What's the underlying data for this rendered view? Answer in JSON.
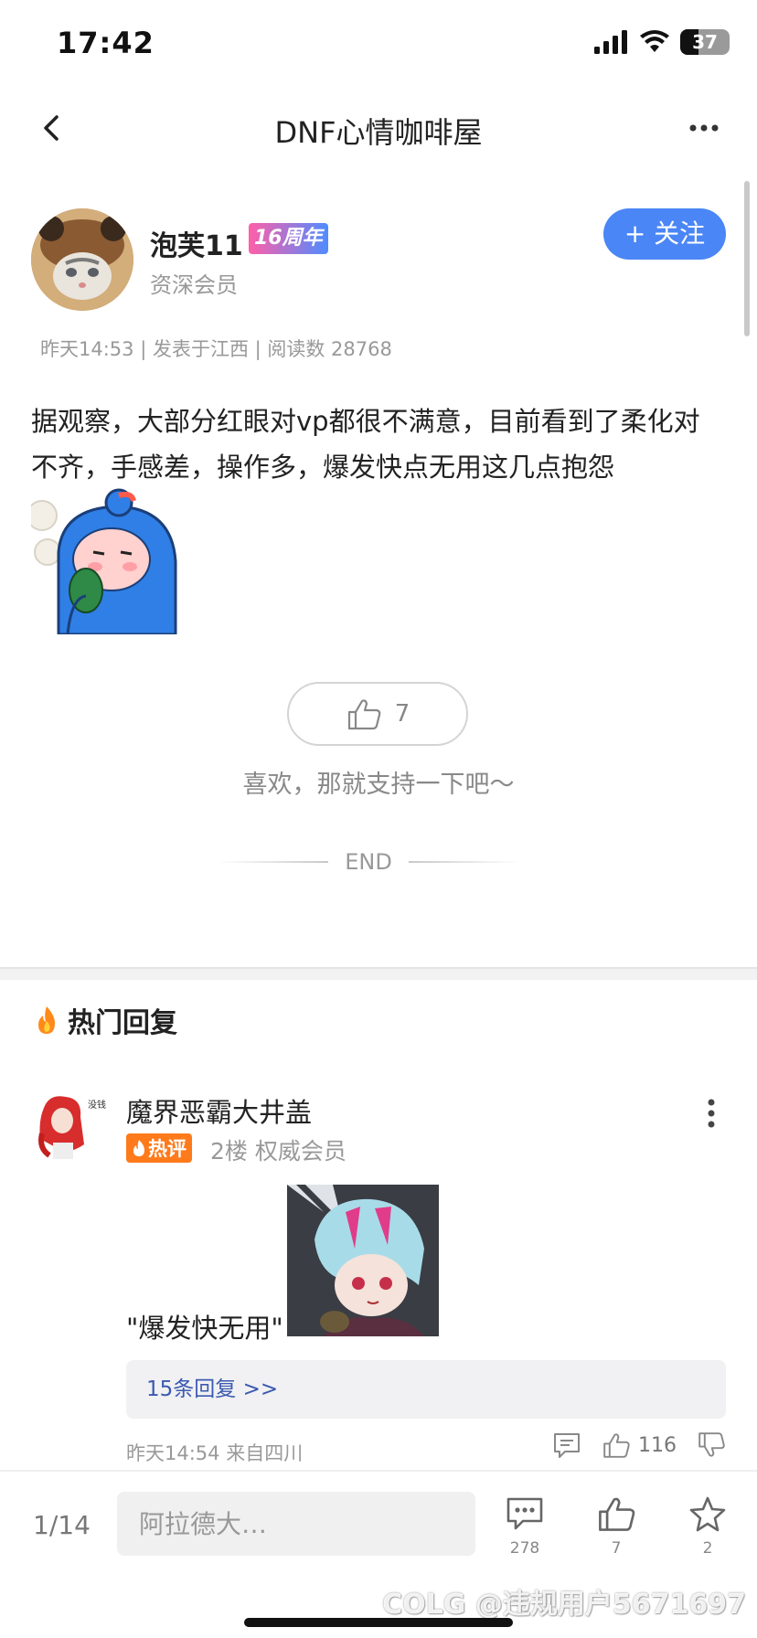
{
  "status_bar": {
    "time": "17:42",
    "battery": "37"
  },
  "nav": {
    "title": "DNF心情咖啡屋"
  },
  "author": {
    "name": "泡芙11",
    "badge": "16周年",
    "role": "资深会员",
    "follow_label": "+ 关注"
  },
  "post": {
    "meta": "昨天14:53 | 发表于江西 | 阅读数 28768",
    "body": "据观察，大部分红眼对vp都很不满意，目前看到了柔化对不齐，手感差，操作多，爆发快点无用这几点抱怨",
    "like_count": "7",
    "like_hint": "喜欢，那就支持一下吧～",
    "end_label": "END"
  },
  "hot_replies": {
    "title": "热门回复",
    "items": [
      {
        "name": "魔界恶霸大井盖",
        "hot_badge": "热评",
        "floor_info": "2楼 权威会员",
        "text": "\"爆发快无用\"",
        "sub_replies": "15条回复 >>",
        "meta": "昨天14:54 来自四川",
        "like_count": "116"
      }
    ]
  },
  "bottom_bar": {
    "page_indicator": "1/14",
    "input_placeholder": "阿拉德大…",
    "comment_count": "278",
    "like_count": "7",
    "favorite_count": "2"
  },
  "watermark": "COLG @违规用户5671697",
  "colors": {
    "accent": "#4a86f5",
    "hot": "#ff7a1a",
    "link": "#3b59b0"
  }
}
